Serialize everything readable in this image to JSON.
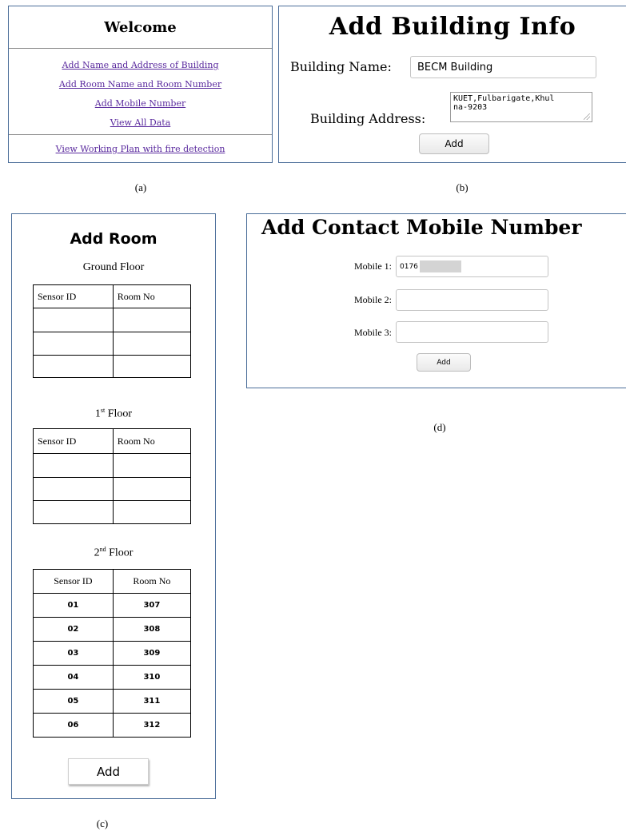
{
  "captions": {
    "a": "(a)",
    "b": "(b)",
    "c": "(c)",
    "d": "(d)"
  },
  "welcome": {
    "title": "Welcome",
    "links": [
      "Add Name and Address of Building",
      "Add Room Name and Room Number",
      "Add Mobile Number",
      "View All Data"
    ],
    "bottom_link": "View Working Plan with fire detection",
    "link_color": "#5a2a9e"
  },
  "building": {
    "title": "Add Building Info",
    "name_label": "Building Name:",
    "name_value": "BECM Building",
    "address_label": "Building Address:",
    "address_value": "KUET,Fulbarigate,Khul\nna-9203",
    "add_label": "Add"
  },
  "room": {
    "title": "Add Room",
    "headers": [
      "Sensor ID",
      "Room No"
    ],
    "ground_label": "Ground Floor",
    "first_num": "1",
    "first_sup": "st",
    "first_rest": " Floor",
    "second_num": "2",
    "second_sup": "nd",
    "second_rest": " Floor",
    "second_rows": [
      [
        "01",
        "307"
      ],
      [
        "02",
        "308"
      ],
      [
        "03",
        "309"
      ],
      [
        "04",
        "310"
      ],
      [
        "05",
        "311"
      ],
      [
        "06",
        "312"
      ]
    ],
    "add_label": "Add"
  },
  "mobile": {
    "title": "Add Contact Mobile Number",
    "labels": [
      "Mobile 1:",
      "Mobile 2:",
      "Mobile 3:"
    ],
    "mobile1_value": "0176",
    "add_label": "Add"
  },
  "colors": {
    "panel_border": "#4a6d99",
    "divider": "#8a8a8a"
  }
}
